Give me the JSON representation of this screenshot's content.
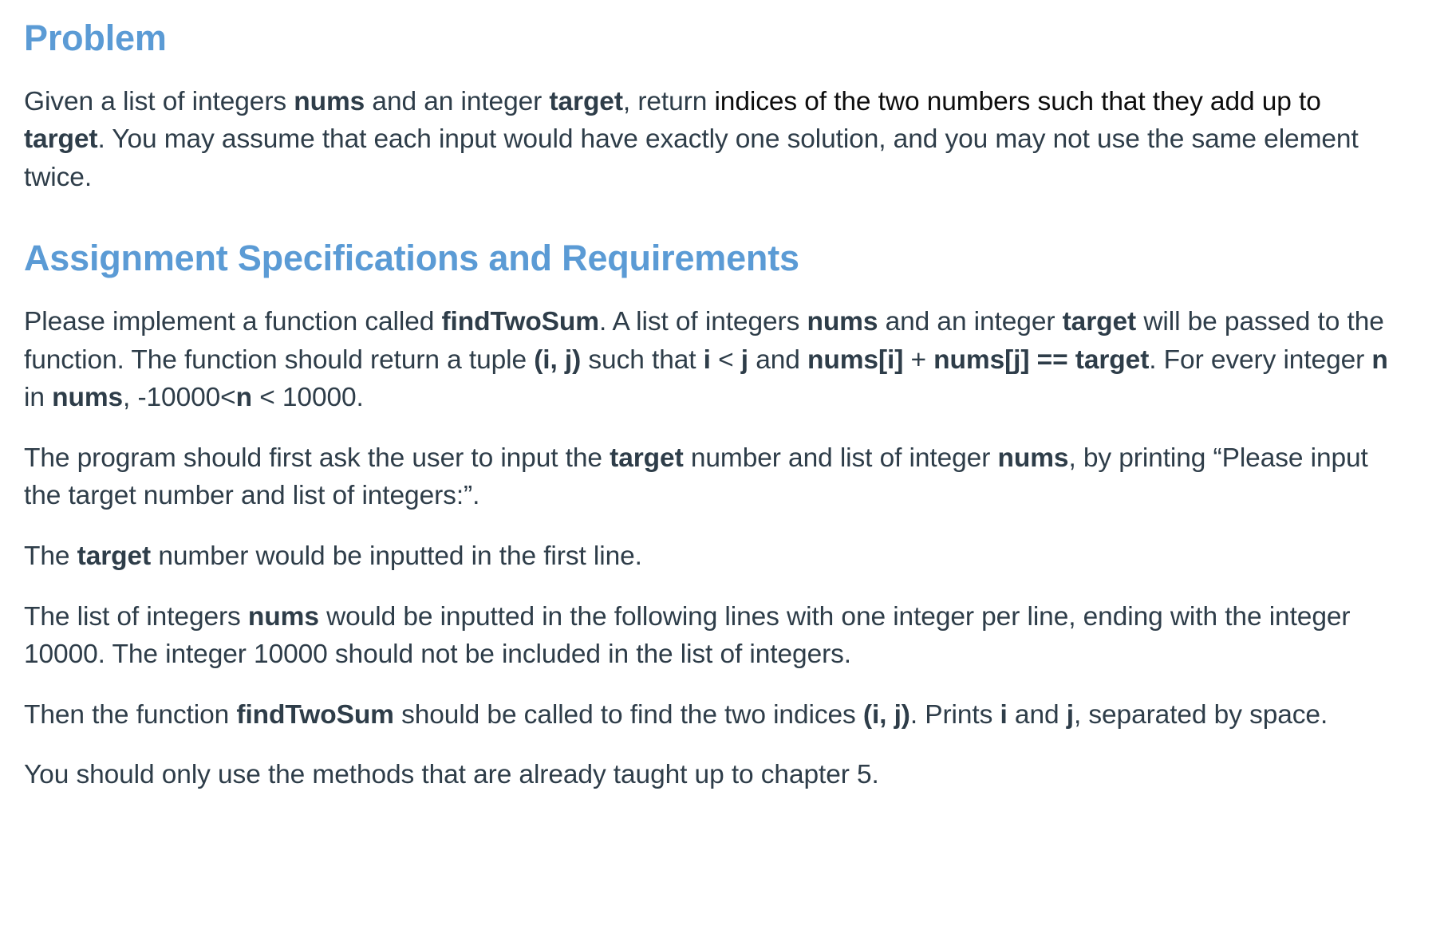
{
  "document": {
    "background_color": "#ffffff",
    "heading_color": "#5b9bd5",
    "body_color": "#2e3d49",
    "emphasis_color": "#0d0d0d"
  },
  "sections": [
    {
      "heading": "Problem",
      "paragraphs": [
        {
          "id": "problem-statement",
          "runs": [
            {
              "text": "Given a list of integers ",
              "style": "plain"
            },
            {
              "text": "nums",
              "style": "bold"
            },
            {
              "text": " and an integer ",
              "style": "plain"
            },
            {
              "text": "target",
              "style": "bold"
            },
            {
              "text": ", return ",
              "style": "plain"
            },
            {
              "text": "indices of the two numbers such that they add up to ",
              "style": "black"
            },
            {
              "text": "target",
              "style": "bold"
            },
            {
              "text": ". You may assume that each input would have exactly one solution, and you may not use the same element twice.",
              "style": "plain"
            }
          ]
        }
      ]
    },
    {
      "heading": "Assignment Specifications and Requirements",
      "paragraphs": [
        {
          "id": "function-signature",
          "runs": [
            {
              "text": "Please implement a function called ",
              "style": "plain"
            },
            {
              "text": "findTwoSum",
              "style": "bold"
            },
            {
              "text": ". A list of integers ",
              "style": "plain"
            },
            {
              "text": "nums",
              "style": "bold"
            },
            {
              "text": " and an integer ",
              "style": "plain"
            },
            {
              "text": "target",
              "style": "bold"
            },
            {
              "text": " will be passed to the function. The function should return a tuple ",
              "style": "plain"
            },
            {
              "text": "(i, j)",
              "style": "bold"
            },
            {
              "text": " such that ",
              "style": "plain"
            },
            {
              "text": "i",
              "style": "bold"
            },
            {
              "text": " < ",
              "style": "plain"
            },
            {
              "text": "j",
              "style": "bold"
            },
            {
              "text": " and ",
              "style": "plain"
            },
            {
              "text": "nums[i]",
              "style": "bold"
            },
            {
              "text": " + ",
              "style": "plain"
            },
            {
              "text": "nums[j] == target",
              "style": "bold"
            },
            {
              "text": ". For every integer ",
              "style": "plain"
            },
            {
              "text": "n",
              "style": "bold"
            },
            {
              "text": " in ",
              "style": "plain"
            },
            {
              "text": "nums",
              "style": "bold"
            },
            {
              "text": ", -10000<",
              "style": "plain"
            },
            {
              "text": "n",
              "style": "bold"
            },
            {
              "text": " < 10000.",
              "style": "plain"
            }
          ]
        },
        {
          "id": "input-prompt",
          "runs": [
            {
              "text": "The program should first ask the user to input the ",
              "style": "plain"
            },
            {
              "text": "target",
              "style": "bold"
            },
            {
              "text": " number and list of integer ",
              "style": "plain"
            },
            {
              "text": "nums",
              "style": "bold"
            },
            {
              "text": ", by printing “Please input the target number and list of integers:”.",
              "style": "plain"
            }
          ]
        },
        {
          "id": "target-first-line",
          "runs": [
            {
              "text": "The ",
              "style": "plain"
            },
            {
              "text": "target",
              "style": "bold"
            },
            {
              "text": " number would be inputted in the first line.",
              "style": "plain"
            }
          ]
        },
        {
          "id": "nums-input-format",
          "runs": [
            {
              "text": "The list of integers ",
              "style": "plain"
            },
            {
              "text": "nums",
              "style": "bold"
            },
            {
              "text": " would be inputted in the following lines with one integer per line, ending with the integer 10000. The integer 10000 should not be included in the list of integers.",
              "style": "plain"
            }
          ]
        },
        {
          "id": "output-format",
          "runs": [
            {
              "text": "Then the function ",
              "style": "plain"
            },
            {
              "text": "findTwoSum",
              "style": "bold"
            },
            {
              "text": " should be called to find the two indices ",
              "style": "plain"
            },
            {
              "text": "(i, j)",
              "style": "bold"
            },
            {
              "text": ". Prints ",
              "style": "plain"
            },
            {
              "text": "i",
              "style": "bold"
            },
            {
              "text": " and ",
              "style": "plain"
            },
            {
              "text": "j",
              "style": "bold"
            },
            {
              "text": ", separated by space.",
              "style": "plain"
            }
          ]
        },
        {
          "id": "allowed-methods",
          "runs": [
            {
              "text": "You should only use the methods that are already taught up to chapter 5.",
              "style": "plain"
            }
          ]
        }
      ]
    }
  ]
}
